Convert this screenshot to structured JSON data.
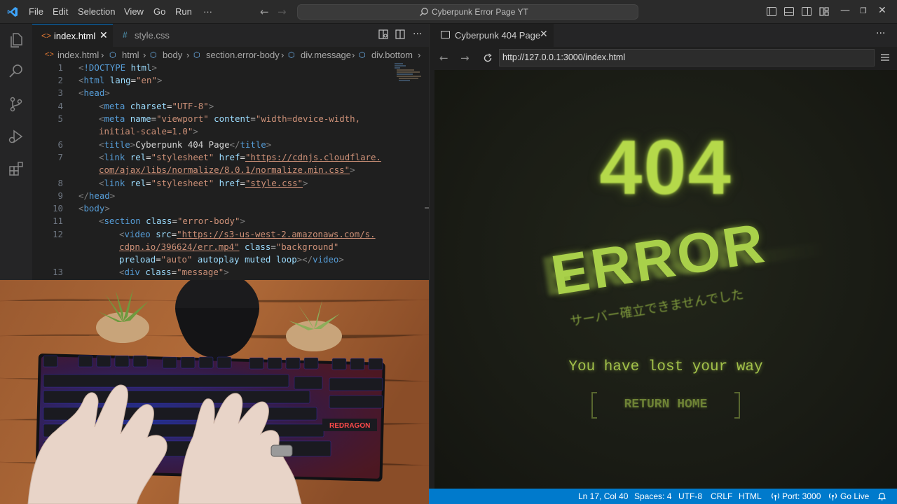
{
  "titlebar": {
    "menu": [
      "File",
      "Edit",
      "Selection",
      "View",
      "Go",
      "Run",
      "···"
    ],
    "search": "Cyberpunk Error Page YT",
    "window_controls": [
      "—",
      "❐",
      "✕"
    ]
  },
  "activity_bar": [
    "explorer-icon",
    "search-icon",
    "source-control-icon",
    "run-debug-icon",
    "extensions-icon"
  ],
  "editor": {
    "tabs": [
      {
        "label": "index.html",
        "icon": "html-icon",
        "active": true
      },
      {
        "label": "style.css",
        "icon": "css-icon",
        "active": false
      }
    ],
    "breadcrumb": [
      "index.html",
      "html",
      "body",
      "section.error-body",
      "div.message",
      "div.bottom"
    ],
    "line_numbers": [
      "1",
      "2",
      "3",
      "4",
      "5",
      "6",
      "7",
      "8",
      "9",
      "10",
      "11",
      "12",
      "13"
    ],
    "code_lines": [
      "<!DOCTYPE html>",
      "<html lang=\"en\">",
      "<head>",
      "<meta charset=\"UTF-8\">",
      "<meta name=\"viewport\" content=\"width=device-width,",
      "initial-scale=1.0\">",
      "<title>Cyberpunk 404 Page</title>",
      "<link rel=\"stylesheet\" href=\"https://cdnjs.cloudflare.",
      "com/ajax/libs/normalize/8.0.1/normalize.min.css\">",
      "<link rel=\"stylesheet\" href=\"style.css\">",
      "</head>",
      "<body>",
      "<section class=\"error-body\">",
      "<video src=\"https://s3-us-west-2.amazonaws.com/s.",
      "cdpn.io/396624/err.mp4\" class=\"background\"",
      "preload=\"auto\" autoplay muted loop></video>",
      "<div class=\"message\">"
    ]
  },
  "preview": {
    "tab_title": "Cyberpunk 404 Page",
    "url": "http://127.0.0.1:3000/index.html",
    "page": {
      "code": "404",
      "error": "ERROR",
      "japanese": "サーバー確立できませんでした",
      "message": "You have lost your way",
      "button": "RETURN HOME"
    },
    "colors": {
      "accent": "#b5d94a",
      "background": "#1b1d16"
    }
  },
  "statusbar": {
    "position": "Ln 17, Col 40",
    "spaces": "Spaces: 4",
    "encoding": "UTF-8",
    "eol": "CRLF",
    "language": "HTML",
    "port": "Port: 3000",
    "golive": "Go Live"
  },
  "webcam": {
    "keyboard_brand": "REDRAGON"
  }
}
